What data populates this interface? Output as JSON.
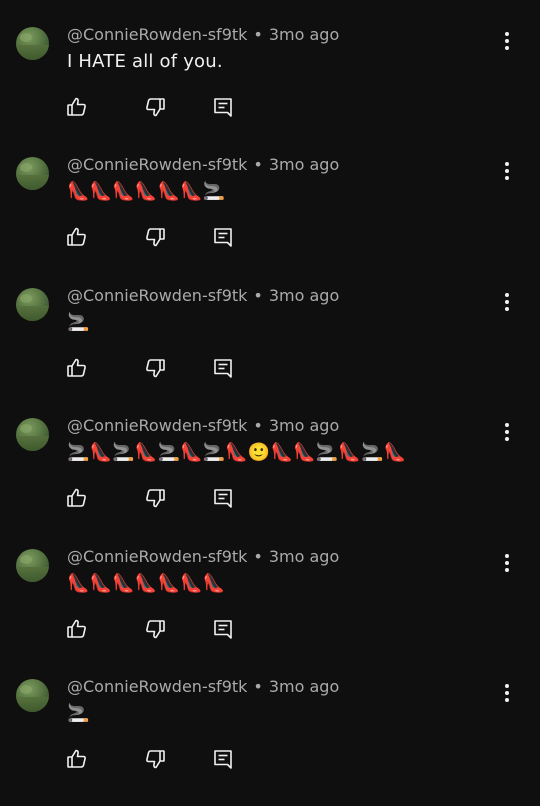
{
  "colors": {
    "background": "#0f0f0f",
    "primary_text": "#f1f1f1",
    "secondary_text": "#aaaaaa"
  },
  "comments": [
    {
      "author": "@ConnieRowden-sf9tk",
      "separator": "•",
      "time": "3mo ago",
      "text": "I HATE all of you."
    },
    {
      "author": "@ConnieRowden-sf9tk",
      "separator": "•",
      "time": "3mo ago",
      "text": "👠👠👠👠👠👠🚬"
    },
    {
      "author": "@ConnieRowden-sf9tk",
      "separator": "•",
      "time": "3mo ago",
      "text": "🚬"
    },
    {
      "author": "@ConnieRowden-sf9tk",
      "separator": "•",
      "time": "3mo ago",
      "text": "🚬👠🚬👠🚬👠🚬👠🙂👠👠🚬👠🚬👠"
    },
    {
      "author": "@ConnieRowden-sf9tk",
      "separator": "•",
      "time": "3mo ago",
      "text": "👠👠👠👠👠👠👠"
    },
    {
      "author": "@ConnieRowden-sf9tk",
      "separator": "•",
      "time": "3mo ago",
      "text": "🚬"
    }
  ],
  "icons": {
    "like": "thumbs-up-icon",
    "dislike": "thumbs-down-icon",
    "reply": "reply-comment-icon",
    "menu": "more-vertical-icon"
  }
}
